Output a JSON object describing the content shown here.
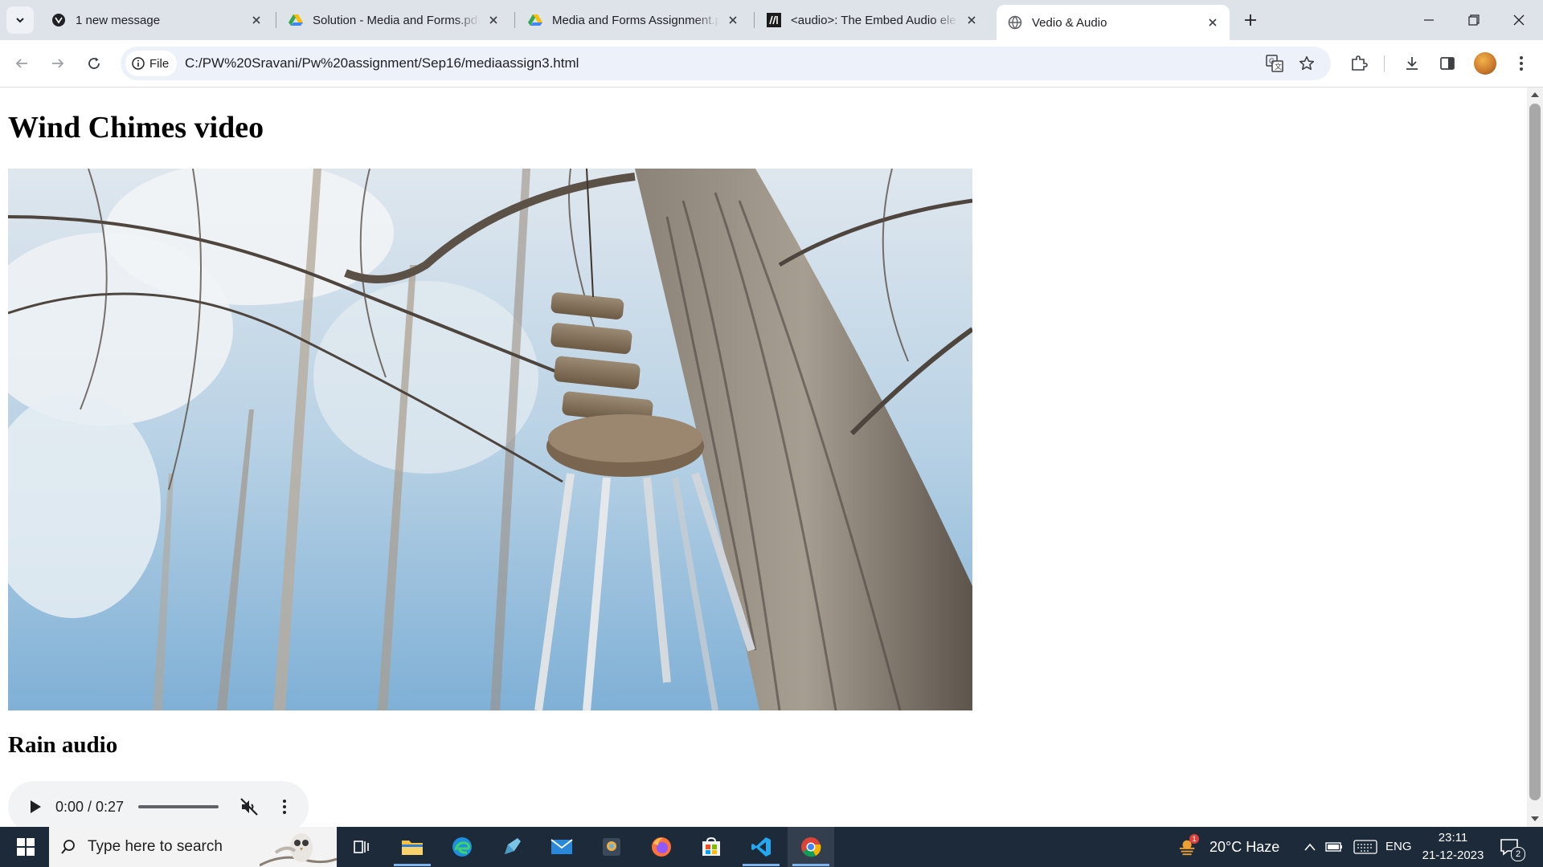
{
  "browser": {
    "tabs": [
      {
        "title": "1 new message",
        "favicon": "mail-circle-icon"
      },
      {
        "title": "Solution - Media and Forms.pdf",
        "favicon": "google-drive-icon"
      },
      {
        "title": "Media and Forms Assignment.p",
        "favicon": "google-drive-icon"
      },
      {
        "title": "<audio>: The Embed Audio ele",
        "favicon": "mdn-icon"
      },
      {
        "title": "Vedio & Audio",
        "favicon": "globe-icon",
        "active": true
      }
    ],
    "chip_label": "File",
    "url": "C:/PW%20Sravani/Pw%20assignment/Sep16/mediaassign3.html"
  },
  "page": {
    "heading": "Wind Chimes video",
    "subheading": "Rain audio",
    "audio": {
      "time": "0:00 / 0:27",
      "muted": true
    }
  },
  "taskbar": {
    "search_placeholder": "Type here to search",
    "weather": "20°C  Haze",
    "language": "ENG",
    "time": "23:11",
    "date": "21-12-2023",
    "notification_count": "2",
    "weather_badge": "1"
  },
  "colors": {
    "tabstrip": "#dee3ea",
    "omnibox": "#edf2fa",
    "taskbar": "#1c2a3a",
    "audio_bg": "#f1f3f4"
  }
}
